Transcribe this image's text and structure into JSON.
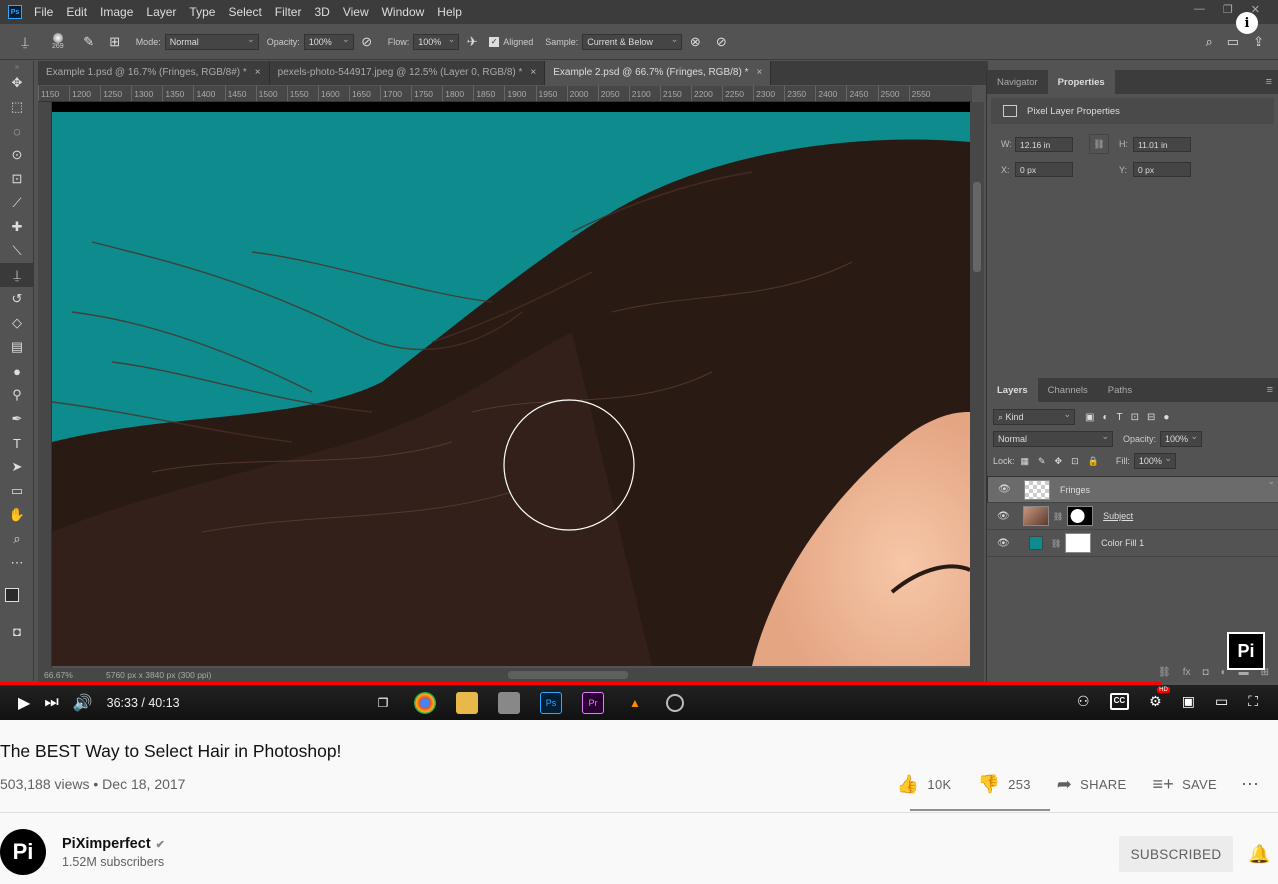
{
  "photoshop": {
    "menu": [
      "File",
      "Edit",
      "Image",
      "Layer",
      "Type",
      "Select",
      "Filter",
      "3D",
      "View",
      "Window",
      "Help"
    ],
    "options": {
      "brush_size": "269",
      "mode_label": "Mode:",
      "mode_value": "Normal",
      "opacity_label": "Opacity:",
      "opacity_value": "100%",
      "flow_label": "Flow:",
      "flow_value": "100%",
      "aligned_label": "Aligned",
      "sample_label": "Sample:",
      "sample_value": "Current & Below"
    },
    "tabs": [
      {
        "label": "Example 1.psd @ 16.7% (Fringes, RGB/8#) *"
      },
      {
        "label": "pexels-photo-544917.jpeg @ 12.5% (Layer 0, RGB/8) *"
      },
      {
        "label": "Example 2.psd @ 66.7% (Fringes, RGB/8) *"
      }
    ],
    "ruler_ticks": [
      "1150",
      "1200",
      "1250",
      "1300",
      "1350",
      "1400",
      "1450",
      "1500",
      "1550",
      "1600",
      "1650",
      "1700",
      "1750",
      "1800",
      "1850",
      "1900",
      "1950",
      "2000",
      "2050",
      "2100",
      "2150",
      "2200",
      "2250",
      "2300",
      "2350",
      "2400",
      "2450",
      "2500",
      "2550"
    ],
    "status": {
      "zoom": "66.67%",
      "dims": "5760 px x 3840 px (300 ppi)"
    },
    "panels": {
      "top_tabs": [
        "Navigator",
        "Properties"
      ],
      "properties_title": "Pixel Layer Properties",
      "w_label": "W:",
      "w_value": "12.16 in",
      "h_label": "H:",
      "h_value": "11.01 in",
      "x_label": "X:",
      "x_value": "0 px",
      "y_label": "Y:",
      "y_value": "0 px",
      "layer_tabs": [
        "Layers",
        "Channels",
        "Paths"
      ],
      "kind_label": "Kind",
      "blend_mode": "Normal",
      "opacity_label": "Opacity:",
      "opacity_value": "100%",
      "lock_label": "Lock:",
      "fill_label": "Fill:",
      "fill_value": "100%",
      "layers": [
        {
          "name": "Fringes"
        },
        {
          "name": "Subject"
        },
        {
          "name": "Color Fill 1"
        }
      ]
    }
  },
  "player": {
    "time": "36:33 / 40:13",
    "progress": 0.909,
    "hd_badge": "HD",
    "cc_label": "CC"
  },
  "video": {
    "title": "The BEST Way to Select Hair in Photoshop!",
    "meta": "503,188 views • Dec 18, 2017",
    "likes": "10K",
    "dislikes": "253",
    "share_label": "SHARE",
    "save_label": "SAVE"
  },
  "channel": {
    "name": "PiXimperfect",
    "subscribers": "1.52M subscribers",
    "subscribe_label": "SUBSCRIBED"
  },
  "colors": {
    "accent": "#ff0000",
    "canvas_bg": "#0e8b8d",
    "hair": "#2a1a14"
  }
}
